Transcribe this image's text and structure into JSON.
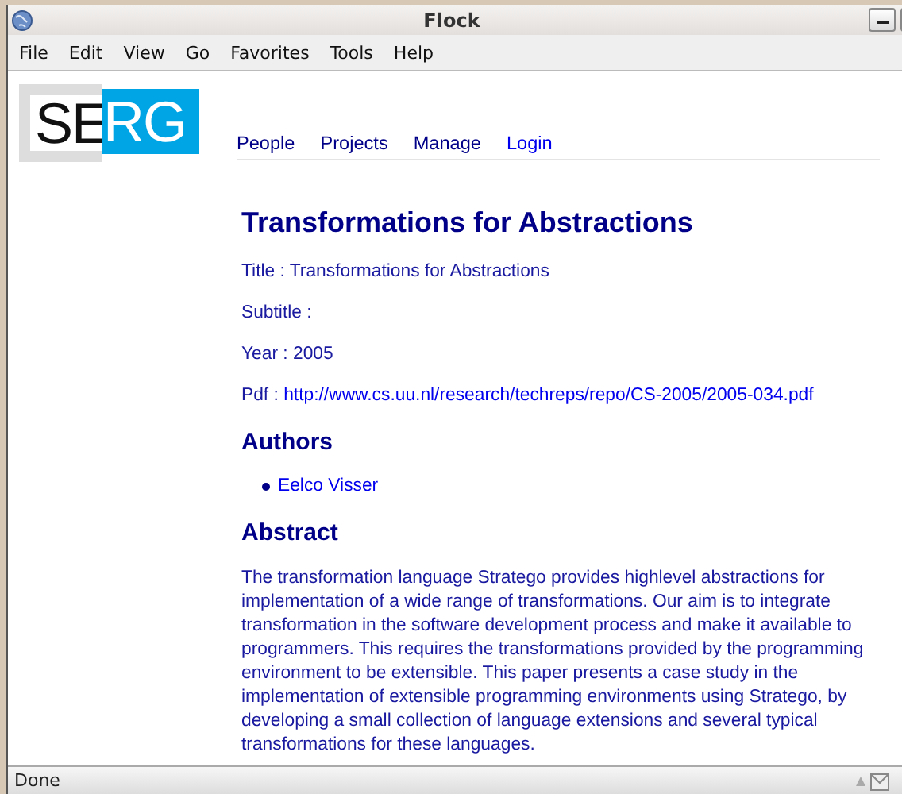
{
  "window": {
    "title": "Flock"
  },
  "menu": [
    "File",
    "Edit",
    "View",
    "Go",
    "Favorites",
    "Tools",
    "Help"
  ],
  "logo": {
    "first": "SE",
    "second": "RG"
  },
  "nav": [
    {
      "label": "People",
      "visited": true
    },
    {
      "label": "Projects",
      "visited": true
    },
    {
      "label": "Manage",
      "visited": true
    },
    {
      "label": "Login",
      "visited": false
    }
  ],
  "heading": "Transformations for Abstractions",
  "fields": [
    {
      "label": "Title : ",
      "value": "Transformations for Abstractions",
      "kind": "text"
    },
    {
      "label": "Subtitle : ",
      "kind": "text"
    },
    {
      "label": "Year : ",
      "value": "2005",
      "kind": "text"
    },
    {
      "label": "Pdf : ",
      "value": "http://www.cs.uu.nl/research/techreps/repo/CS-2005/2005-034.pdf",
      "kind": "link"
    }
  ],
  "authors_heading": "Authors",
  "authors": [
    "Eelco Visser"
  ],
  "abstract_heading": "Abstract",
  "abstract": "The transformation language Stratego provides highlevel abstractions for implementation of a wide range of transformations. Our aim is to integrate transformation in the software development process and make it available to programmers. This requires the transformations provided by the programming environment to be extensible. This paper presents a case study in the implementation of extensible programming environments using Stratego, by developing a small collection of language extensions and several typical transformations for these languages.",
  "status_bar": {
    "text": "Done"
  }
}
